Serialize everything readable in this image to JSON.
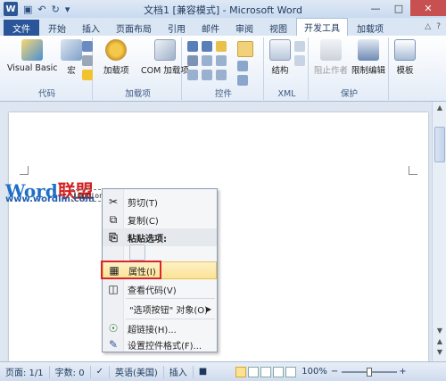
{
  "window": {
    "title": "文档1 [兼容模式] - Microsoft Word",
    "app_letter": "W"
  },
  "quick_access": {
    "undo_glyph": "↶",
    "redo_glyph": "↻"
  },
  "tabs": [
    {
      "label": "文件"
    },
    {
      "label": "开始"
    },
    {
      "label": "插入"
    },
    {
      "label": "页面布局"
    },
    {
      "label": "引用"
    },
    {
      "label": "邮件"
    },
    {
      "label": "审阅"
    },
    {
      "label": "视图"
    },
    {
      "label": "开发工具"
    },
    {
      "label": "加载项"
    }
  ],
  "ribbon": {
    "groups": {
      "code": {
        "label": "代码",
        "buttons": [
          "Visual Basic",
          "宏"
        ]
      },
      "addins": {
        "label": "加载项",
        "buttons": [
          "加载项",
          "COM 加载项"
        ]
      },
      "controls": {
        "label": "控件"
      },
      "xml": {
        "label": "XML",
        "buttons": [
          "结构"
        ]
      },
      "protect": {
        "label": "保护",
        "buttons": [
          "阻止作者",
          "限制编辑"
        ]
      },
      "templates": {
        "buttons": [
          "模板"
        ]
      }
    },
    "icons": {
      "vba": "visual-basic-icon",
      "macro": "macro-icon",
      "addin": "gear-icon",
      "com_addin": "com-addin-icon",
      "structure": "structure-icon",
      "block": "block-authors-icon",
      "restrict": "restrict-editing-icon",
      "template": "template-icon"
    }
  },
  "document": {
    "logo": {
      "text_w": "W",
      "text_ord": "ord",
      "text_cn": "联盟",
      "url": "www.wordlm.com"
    },
    "option_button_label": "OptionButton1"
  },
  "context_menu": {
    "items": [
      {
        "label": "剪切(T)",
        "icon": "cut-icon"
      },
      {
        "label": "复制(C)",
        "icon": "copy-icon"
      },
      {
        "label": "粘贴选项:",
        "icon": "paste-icon"
      },
      {
        "label": "属性(I)",
        "icon": "properties-icon"
      },
      {
        "label": "查看代码(V)",
        "icon": "view-code-icon"
      },
      {
        "label": "\"选项按钮\" 对象(O)",
        "icon": ""
      },
      {
        "label": "超链接(H)...",
        "icon": "hyperlink-icon"
      },
      {
        "label": "设置控件格式(F)...",
        "icon": "format-control-icon"
      }
    ]
  },
  "status": {
    "page": "页面: 1/1",
    "words": "字数: 0",
    "language": "英语(美国)",
    "mode": "插入",
    "zoom": "100%"
  },
  "colors": {
    "accent": "#2a5699",
    "highlight": "#fbe394",
    "red_box": "#d8262a"
  }
}
